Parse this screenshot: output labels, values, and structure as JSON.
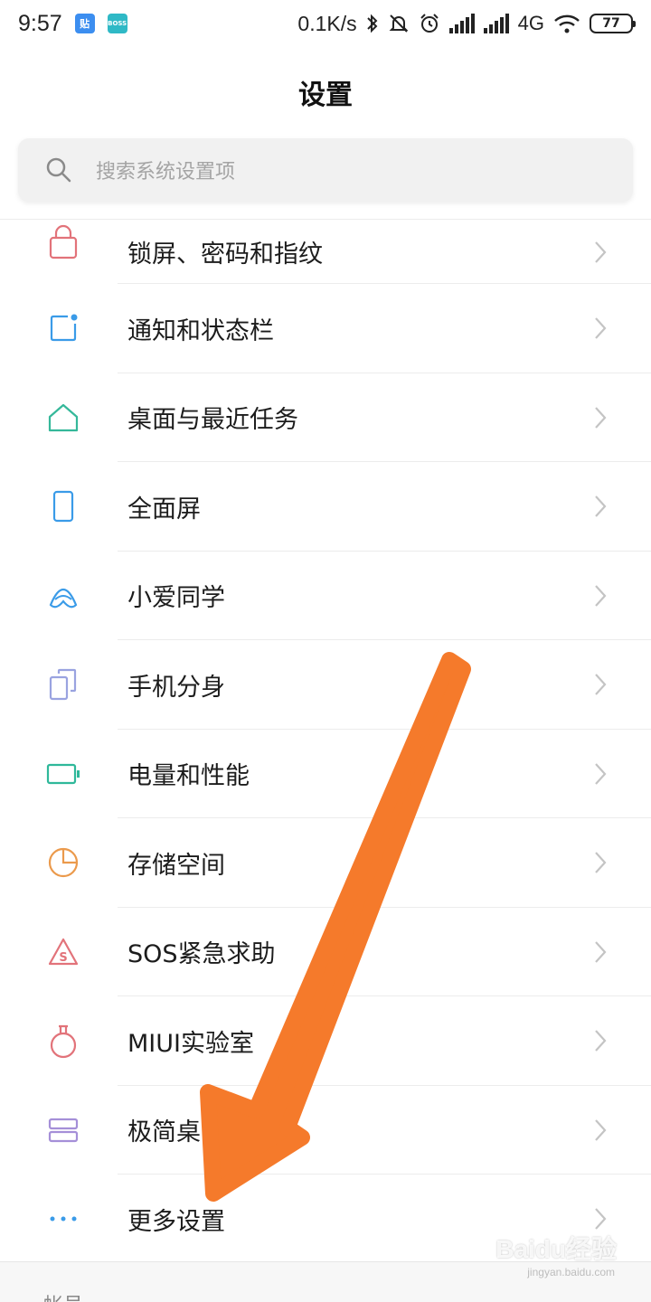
{
  "status_bar": {
    "time": "9:57",
    "app_badges": [
      "贴",
      "BOSS"
    ],
    "net_speed": "0.1K/s",
    "network": "4G",
    "battery": "77"
  },
  "header": {
    "title": "设置"
  },
  "search": {
    "placeholder": "搜索系统设置项"
  },
  "settings_items": [
    {
      "label": "锁屏、密码和指纹",
      "icon": "lock-icon",
      "color": "#e2737a"
    },
    {
      "label": "通知和状态栏",
      "icon": "notification-icon",
      "color": "#3a9be8"
    },
    {
      "label": "桌面与最近任务",
      "icon": "home-icon",
      "color": "#35b89a"
    },
    {
      "label": "全面屏",
      "icon": "phone-screen-icon",
      "color": "#3a9be8"
    },
    {
      "label": "小爱同学",
      "icon": "xiaoai-icon",
      "color": "#3a9be8"
    },
    {
      "label": "手机分身",
      "icon": "dual-phone-icon",
      "color": "#9aa3e0"
    },
    {
      "label": "电量和性能",
      "icon": "battery-icon",
      "color": "#2fb89a"
    },
    {
      "label": "存储空间",
      "icon": "storage-pie-icon",
      "color": "#eb9a4c"
    },
    {
      "label": "SOS紧急求助",
      "icon": "sos-icon",
      "color": "#e2737a"
    },
    {
      "label": "MIUI实验室",
      "icon": "lab-flask-icon",
      "color": "#e2737a"
    },
    {
      "label": "极简桌面",
      "icon": "minimal-desktop-icon",
      "color": "#a58fd8"
    },
    {
      "label": "更多设置",
      "icon": "more-dots-icon",
      "color": "#3a9be8"
    }
  ],
  "footer": {
    "section_label": "帐号"
  },
  "watermark": {
    "brand": "Baidu经验",
    "url": "jingyan.baidu.com"
  },
  "annotation": {
    "arrow_color": "#f57a2b"
  }
}
